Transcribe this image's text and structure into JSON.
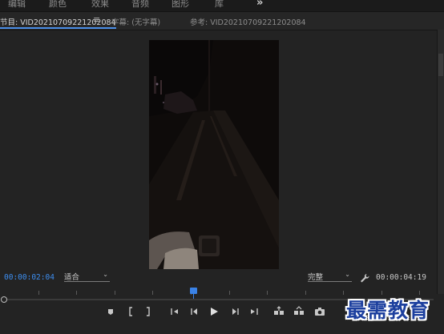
{
  "topbar": {
    "workspaces": [
      "编辑",
      "颜色",
      "效果",
      "音频",
      "图形",
      "库"
    ],
    "more": "»"
  },
  "tabs": {
    "program": "节目: VID20210709221202084",
    "menu": "≡",
    "captions": "字幕: (无字幕)",
    "reference": "参考: VID20210709221202084"
  },
  "controls": {
    "current_timecode": "00:00:02:04",
    "fit": "适合",
    "quality": "完整",
    "duration_timecode": "00:00:04:19"
  },
  "transport_icons": [
    "add-marker-icon",
    "mark-in-icon",
    "mark-out-icon",
    "go-to-in-icon",
    "step-back-icon",
    "play-icon",
    "step-forward-icon",
    "go-to-out-icon",
    "lift-icon",
    "extract-icon",
    "export-frame-icon"
  ],
  "playhead_fraction": 0.45,
  "colors": {
    "accent": "#3d8ef0",
    "background": "#232323",
    "watermark": "#1c3f9e"
  },
  "watermark": "最需教育"
}
